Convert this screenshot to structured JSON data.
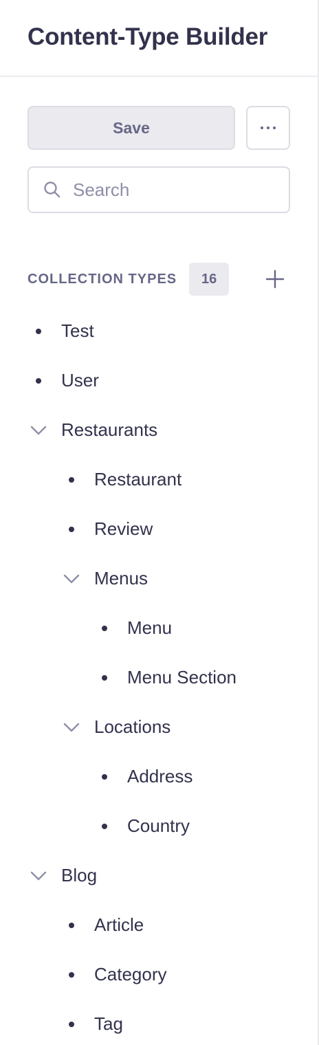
{
  "header": {
    "title": "Content-Type Builder"
  },
  "toolbar": {
    "save_label": "Save",
    "more_icon": "more-horizontal-icon"
  },
  "search": {
    "placeholder": "Search",
    "value": ""
  },
  "collection_types": {
    "title": "COLLECTION TYPES",
    "count": "16",
    "items": [
      {
        "label": "Test",
        "level": 0,
        "kind": "item"
      },
      {
        "label": "User",
        "level": 0,
        "kind": "item"
      },
      {
        "label": "Restaurants",
        "level": 0,
        "kind": "group",
        "expanded": true
      },
      {
        "label": "Restaurant",
        "level": 1,
        "kind": "item"
      },
      {
        "label": "Review",
        "level": 1,
        "kind": "item"
      },
      {
        "label": "Menus",
        "level": 1,
        "kind": "group",
        "expanded": true
      },
      {
        "label": "Menu",
        "level": 2,
        "kind": "item"
      },
      {
        "label": "Menu Section",
        "level": 2,
        "kind": "item"
      },
      {
        "label": "Locations",
        "level": 1,
        "kind": "group",
        "expanded": true
      },
      {
        "label": "Address",
        "level": 2,
        "kind": "item"
      },
      {
        "label": "Country",
        "level": 2,
        "kind": "item"
      },
      {
        "label": "Blog",
        "level": 0,
        "kind": "group",
        "expanded": true
      },
      {
        "label": "Article",
        "level": 1,
        "kind": "item"
      },
      {
        "label": "Category",
        "level": 1,
        "kind": "item"
      },
      {
        "label": "Tag",
        "level": 1,
        "kind": "item"
      }
    ]
  },
  "colors": {
    "text": "#32324d",
    "muted": "#666687",
    "border": "#dcdce4",
    "neutral_bg": "#eaeaef"
  }
}
